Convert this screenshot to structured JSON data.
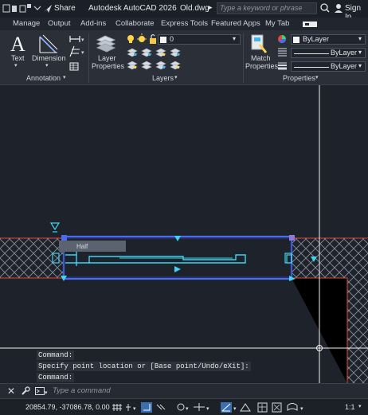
{
  "titlebar": {
    "share_label": "Share",
    "app_title": "Autodesk AutoCAD 2026",
    "file_name": "Old.dwg",
    "search_placeholder": "Type a keyword or phrase",
    "sign_in_label": "Sign In"
  },
  "menu_tabs": [
    "Manage",
    "Output",
    "Add-ins",
    "Collaborate",
    "Express Tools",
    "Featured Apps",
    "My Tab"
  ],
  "ribbon": {
    "annotation": {
      "text_label": "Text",
      "dimension_label": "Dimension",
      "panel_title": "Annotation"
    },
    "layers": {
      "layer_properties_label_1": "Layer",
      "layer_properties_label_2": "Properties",
      "current_layer": "0",
      "panel_title": "Layers"
    },
    "properties": {
      "match_label_1": "Match",
      "match_label_2": "Properties",
      "color_value": "ByLayer",
      "linetype_value": "ByLayer",
      "lineweight_value": "ByLayer",
      "panel_title": "Properties"
    }
  },
  "drawing": {
    "block_label": "Half"
  },
  "command_history": [
    "Command:",
    "Specify point location or [Base point/Undo/eXit]:",
    "Command:"
  ],
  "command_input_placeholder": "Type a command",
  "statusbar": {
    "coordinates": "20854.79, -37086.78, 0.00",
    "scale": "1:1"
  },
  "colors": {
    "background": "#1e222b",
    "selection_blue": "#4a6cf0",
    "cyan_geometry": "#3fd3ef",
    "red_hatch": "#e04a3a",
    "crosshair": "#ffffff"
  }
}
